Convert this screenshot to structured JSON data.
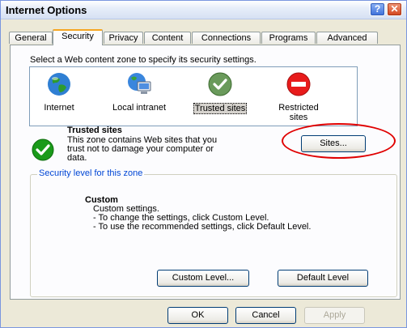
{
  "window": {
    "title": "Internet Options"
  },
  "titlebar_buttons": {
    "help": "?",
    "close": "✕"
  },
  "tabs": [
    {
      "label": "General"
    },
    {
      "label": "Security"
    },
    {
      "label": "Privacy"
    },
    {
      "label": "Content"
    },
    {
      "label": "Connections"
    },
    {
      "label": "Programs"
    },
    {
      "label": "Advanced"
    }
  ],
  "active_tab": "Security",
  "zone_prompt": "Select a Web content zone to specify its security settings.",
  "zones": [
    {
      "label": "Internet",
      "icon": "globe-icon"
    },
    {
      "label": "Local intranet",
      "icon": "computer-network-icon"
    },
    {
      "label": "Trusted sites",
      "icon": "check-icon",
      "selected": true
    },
    {
      "label_line1": "Restricted",
      "label_line2": "sites",
      "icon": "stop-icon"
    }
  ],
  "selected_zone": {
    "title": "Trusted sites",
    "desc_line1": "This zone contains Web sites that you",
    "desc_line2": "trust not to damage your computer or",
    "desc_line3": "data.",
    "sites_button": "Sites...",
    "icon": "check-icon"
  },
  "security_level": {
    "legend": "Security level for this zone",
    "custom_title": "Custom",
    "line1": "Custom settings.",
    "line2": "- To change the settings, click Custom Level.",
    "line3": "- To use the recommended settings, click Default Level.",
    "custom_level_button": "Custom Level...",
    "default_level_button": "Default Level"
  },
  "footer": {
    "ok": "OK",
    "cancel": "Cancel",
    "apply": "Apply"
  },
  "colors": {
    "accent": "#f5a623",
    "highlight_circle": "#e00000",
    "legend_blue": "#0046d5"
  }
}
